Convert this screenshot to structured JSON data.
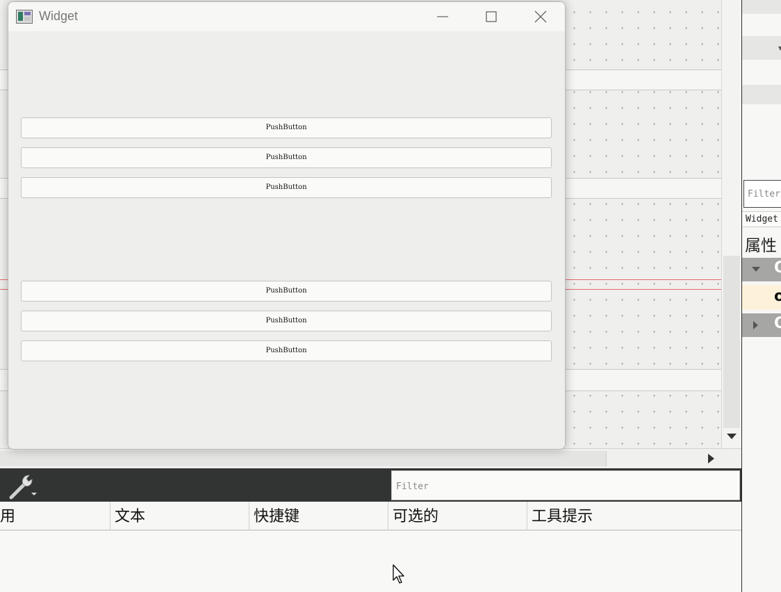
{
  "window": {
    "title": "Widget",
    "buttons": [
      "PushButton",
      "PushButton",
      "PushButton",
      "PushButton",
      "PushButton",
      "PushButton"
    ]
  },
  "property_panel": {
    "filter_placeholder": "Filter",
    "object_label": "Widget",
    "header": "属性",
    "group1_letter": "Q",
    "group2_letter": "Q",
    "prop_letter": "o"
  },
  "action_editor": {
    "filter_placeholder": "Filter",
    "columns": [
      "用",
      "文本",
      "快捷键",
      "可选的",
      "工具提示"
    ]
  },
  "icons": {
    "window": "app-window-icon",
    "tools": "wrench-icon"
  }
}
